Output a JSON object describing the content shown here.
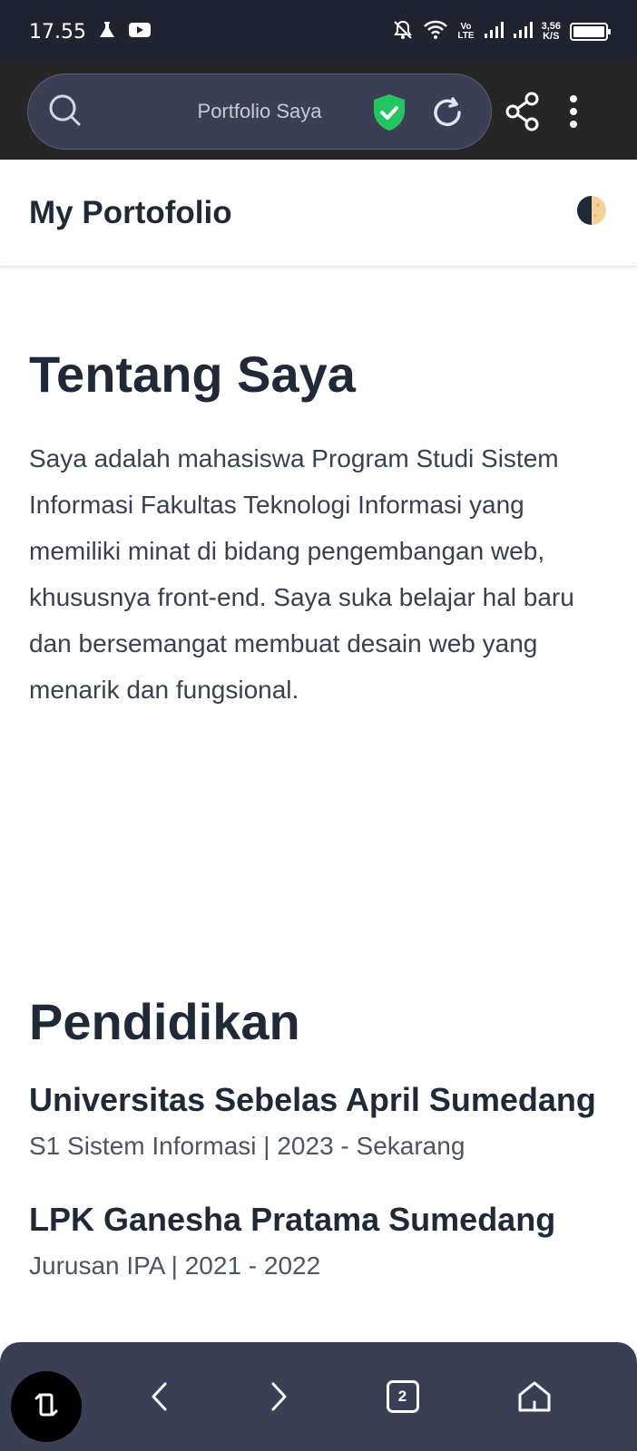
{
  "status_bar": {
    "time": "17.55",
    "volte_top": "Vo",
    "volte_bottom": "LTE",
    "net_speed_value": "3,56",
    "net_speed_unit": "K/S"
  },
  "browser": {
    "address_text": "Portfolio Saya"
  },
  "header": {
    "title": "My Portofolio"
  },
  "about": {
    "title": "Tentang Saya",
    "text": "Saya adalah mahasiswa Program Studi Sistem Informasi Fakultas Teknologi Informasi yang memiliki minat di bidang pengembangan web, khususnya front-end. Saya suka belajar hal baru dan bersemangat membuat desain web yang menarik dan fungsional."
  },
  "education": {
    "title": "Pendidikan",
    "items": [
      {
        "name": "Universitas Sebelas April Sumedang",
        "detail": "S1 Sistem Informasi | 2023 - Sekarang"
      },
      {
        "name": "LPK Ganesha Pratama Sumedang",
        "detail": "Jurusan IPA | 2021 - 2022"
      }
    ]
  },
  "bottom_nav": {
    "tab_count": "2"
  },
  "colors": {
    "status_bar_bg": "#1f2430",
    "browser_bar_bg": "#262626",
    "address_bg": "#3b3f55",
    "shield_green": "#22c55e",
    "heading_text": "#1f2937",
    "body_text": "#374151"
  }
}
